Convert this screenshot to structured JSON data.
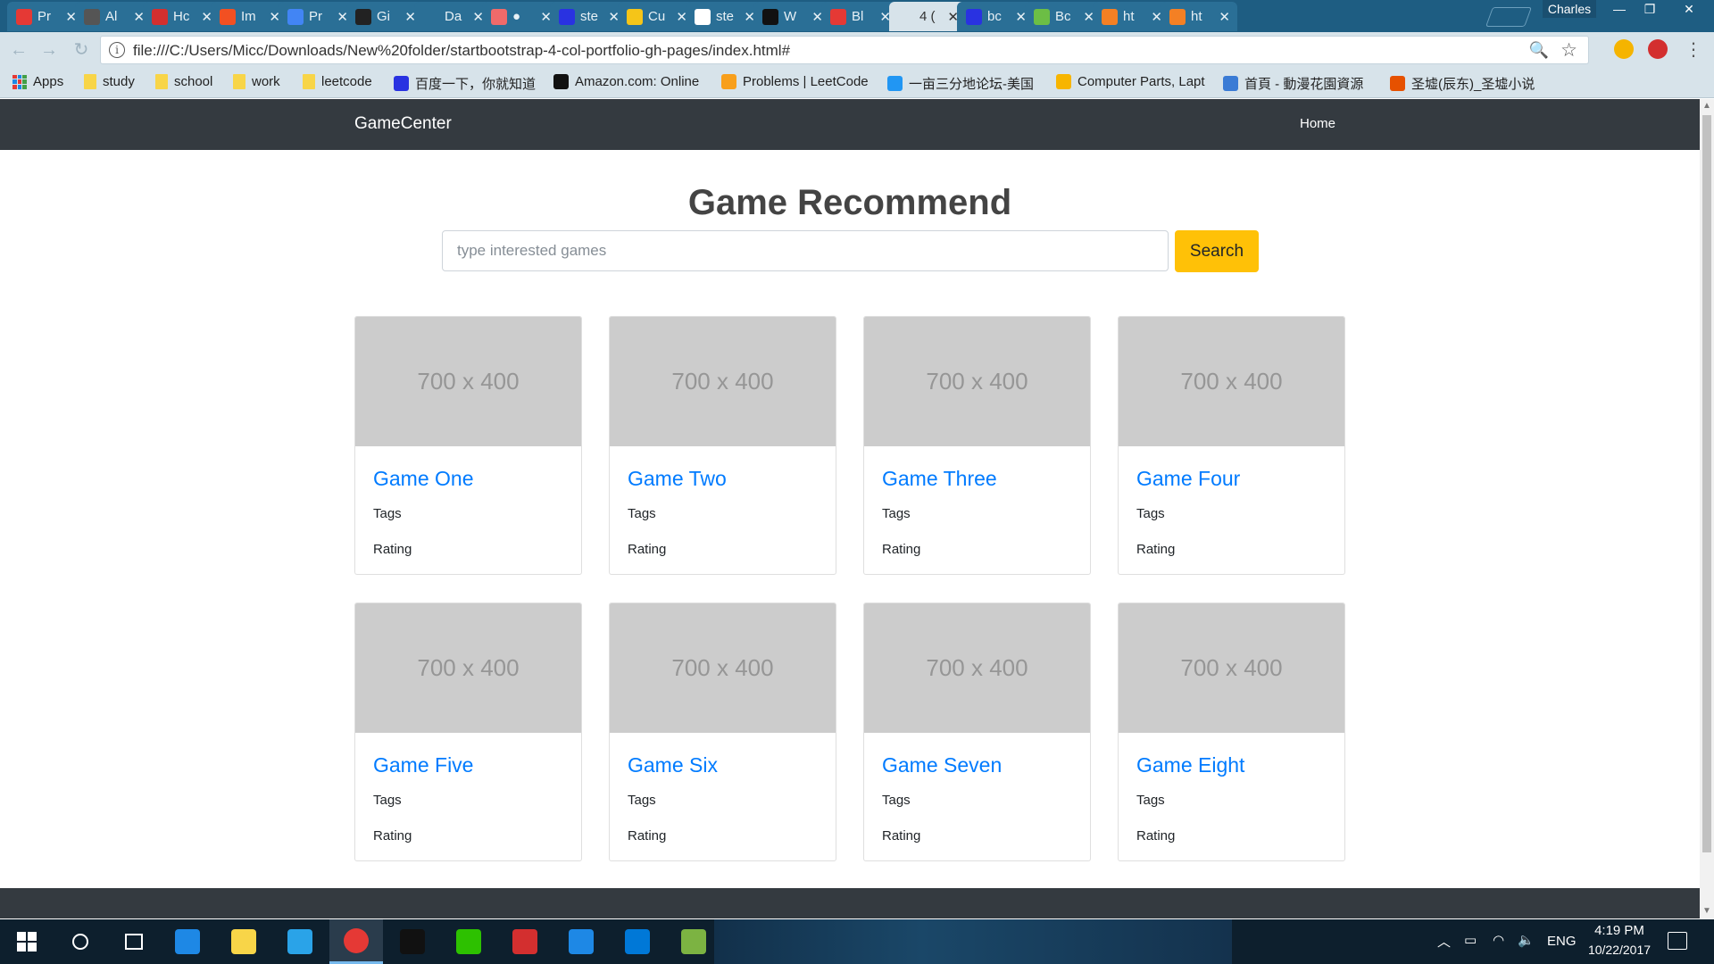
{
  "browser": {
    "tabs": [
      {
        "title": "Pr",
        "icon": "puzzle-icon",
        "color": "#e53935"
      },
      {
        "title": "Al",
        "icon": "grid-app-icon",
        "color": "#555555"
      },
      {
        "title": "Hc",
        "icon": "stack-icon",
        "color": "#d32f2f"
      },
      {
        "title": "Im",
        "icon": "microsoft-icon",
        "color": "#f25022"
      },
      {
        "title": "Pr",
        "icon": "docs-icon",
        "color": "#4285f4"
      },
      {
        "title": "Gi",
        "icon": "github-icon",
        "color": "#222222"
      },
      {
        "title": "Da",
        "icon": "blank-page-icon",
        "color": "#2a6f96"
      },
      {
        "title": "●",
        "icon": "asana-icon",
        "color": "#f06a6a"
      },
      {
        "title": "ste",
        "icon": "paw-icon",
        "color": "#2932e1"
      },
      {
        "title": "Cu",
        "icon": "hero-icon",
        "color": "#f5c518"
      },
      {
        "title": "ste",
        "icon": "google-icon",
        "color": "#ffffff"
      },
      {
        "title": "W",
        "icon": "mask-icon",
        "color": "#111111"
      },
      {
        "title": "Bl",
        "icon": "s-icon",
        "color": "#e53935"
      },
      {
        "title": "4 (",
        "icon": "page-icon",
        "color": "#d7e3ea",
        "active": true
      },
      {
        "title": "bc",
        "icon": "paw-icon",
        "color": "#2932e1"
      },
      {
        "title": "Bc",
        "icon": "bootstrap-icon",
        "color": "#6cbe45"
      },
      {
        "title": "ht",
        "icon": "stackoverflow-icon",
        "color": "#f48024"
      },
      {
        "title": "ht",
        "icon": "stackoverflow-icon",
        "color": "#f48024"
      }
    ],
    "profile_name": "Charles",
    "address_url": "file:///C:/Users/Micc/Downloads/New%20folder/startbootstrap-4-col-portfolio-gh-pages/index.html#",
    "bookmarks": [
      {
        "label": "Apps",
        "icon": "apps-grid-icon"
      },
      {
        "label": "study",
        "icon": "folder-icon"
      },
      {
        "label": "school",
        "icon": "folder-icon"
      },
      {
        "label": "work",
        "icon": "folder-icon"
      },
      {
        "label": "leetcode",
        "icon": "folder-icon"
      },
      {
        "label": "百度一下，你就知道",
        "icon": "baidu-icon",
        "color": "#2932e1"
      },
      {
        "label": "Amazon.com: Online",
        "icon": "amazon-icon",
        "color": "#111111"
      },
      {
        "label": "Problems | LeetCode",
        "icon": "leetcode-icon",
        "color": "#f89f1b"
      },
      {
        "label": "一亩三分地论坛-美国",
        "icon": "forum-icon",
        "color": "#2196f3"
      },
      {
        "label": "Computer Parts, Lapt",
        "icon": "newegg-icon",
        "color": "#f7b500"
      },
      {
        "label": "首頁 - 動漫花園資源",
        "icon": "dmhy-icon",
        "color": "#3a7bd5"
      },
      {
        "label": "圣墟(辰东)_圣墟小说",
        "icon": "house-icon",
        "color": "#e65100"
      }
    ]
  },
  "page": {
    "brand": "GameCenter",
    "nav_home": "Home",
    "heading": "Game Recommend",
    "search_placeholder": "type interested games",
    "search_button": "Search",
    "cards": [
      {
        "image_text": "700 x 400",
        "title": "Game One",
        "tags": "Tags",
        "rating": "Rating"
      },
      {
        "image_text": "700 x 400",
        "title": "Game Two",
        "tags": "Tags",
        "rating": "Rating"
      },
      {
        "image_text": "700 x 400",
        "title": "Game Three",
        "tags": "Tags",
        "rating": "Rating"
      },
      {
        "image_text": "700 x 400",
        "title": "Game Four",
        "tags": "Tags",
        "rating": "Rating"
      },
      {
        "image_text": "700 x 400",
        "title": "Game Five",
        "tags": "Tags",
        "rating": "Rating"
      },
      {
        "image_text": "700 x 400",
        "title": "Game Six",
        "tags": "Tags",
        "rating": "Rating"
      },
      {
        "image_text": "700 x 400",
        "title": "Game Seven",
        "tags": "Tags",
        "rating": "Rating"
      },
      {
        "image_text": "700 x 400",
        "title": "Game Eight",
        "tags": "Tags",
        "rating": "Rating"
      }
    ],
    "colors": {
      "navbar": "#343a40",
      "link": "#007bff",
      "search_button": "#ffc107",
      "placeholder_image": "#cccccc"
    }
  },
  "taskbar": {
    "apps": [
      {
        "name": "start-button",
        "icon": "windows-icon"
      },
      {
        "name": "cortana-button",
        "icon": "circle-icon"
      },
      {
        "name": "task-view-button",
        "icon": "task-view-icon"
      },
      {
        "name": "edge-app",
        "icon": "edge-icon",
        "color": "#1e88e5"
      },
      {
        "name": "file-explorer-app",
        "icon": "folder-icon",
        "color": "#f8d548"
      },
      {
        "name": "input-method-app",
        "icon": "keyboard-app-icon",
        "color": "#2aa3e8"
      },
      {
        "name": "chrome-app",
        "icon": "chrome-icon",
        "color": "#e53935",
        "active": true
      },
      {
        "name": "qq-app",
        "icon": "penguin-icon",
        "color": "#111111"
      },
      {
        "name": "wechat-app",
        "icon": "wechat-icon",
        "color": "#2dc100"
      },
      {
        "name": "acrobat-app",
        "icon": "acrobat-icon",
        "color": "#d32f2f"
      },
      {
        "name": "k-app",
        "icon": "k-icon",
        "color": "#1e88e5"
      },
      {
        "name": "outlook-app",
        "icon": "mail-app-icon",
        "color": "#0078d7"
      },
      {
        "name": "notepad-app",
        "icon": "notepad-icon",
        "color": "#7cb342"
      }
    ],
    "language": "ENG",
    "time": "4:19 PM",
    "date": "10/22/2017"
  }
}
